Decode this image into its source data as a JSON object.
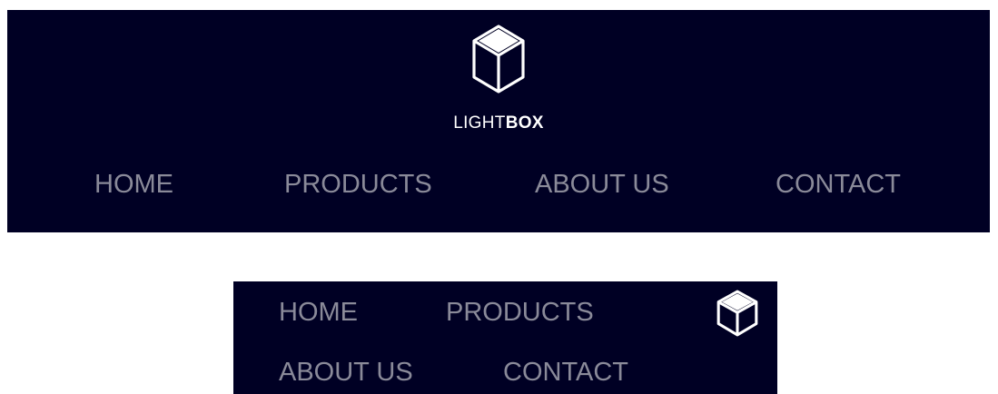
{
  "brand": {
    "light_text": "LIGHT",
    "bold_text": "BOX",
    "logo_icon": "box-icon"
  },
  "wide_nav": {
    "items": [
      {
        "label": "HOME"
      },
      {
        "label": "PRODUCTS"
      },
      {
        "label": "ABOUT US"
      },
      {
        "label": "CONTACT"
      }
    ]
  },
  "narrow_nav": {
    "items": [
      {
        "label": "HOME"
      },
      {
        "label": "PRODUCTS"
      },
      {
        "label": "ABOUT US"
      },
      {
        "label": "CONTACT"
      }
    ],
    "logo_icon": "box-icon"
  },
  "colors": {
    "nav_background": "#000024",
    "link_text": "#8a8a99",
    "logo": "#ffffff"
  }
}
